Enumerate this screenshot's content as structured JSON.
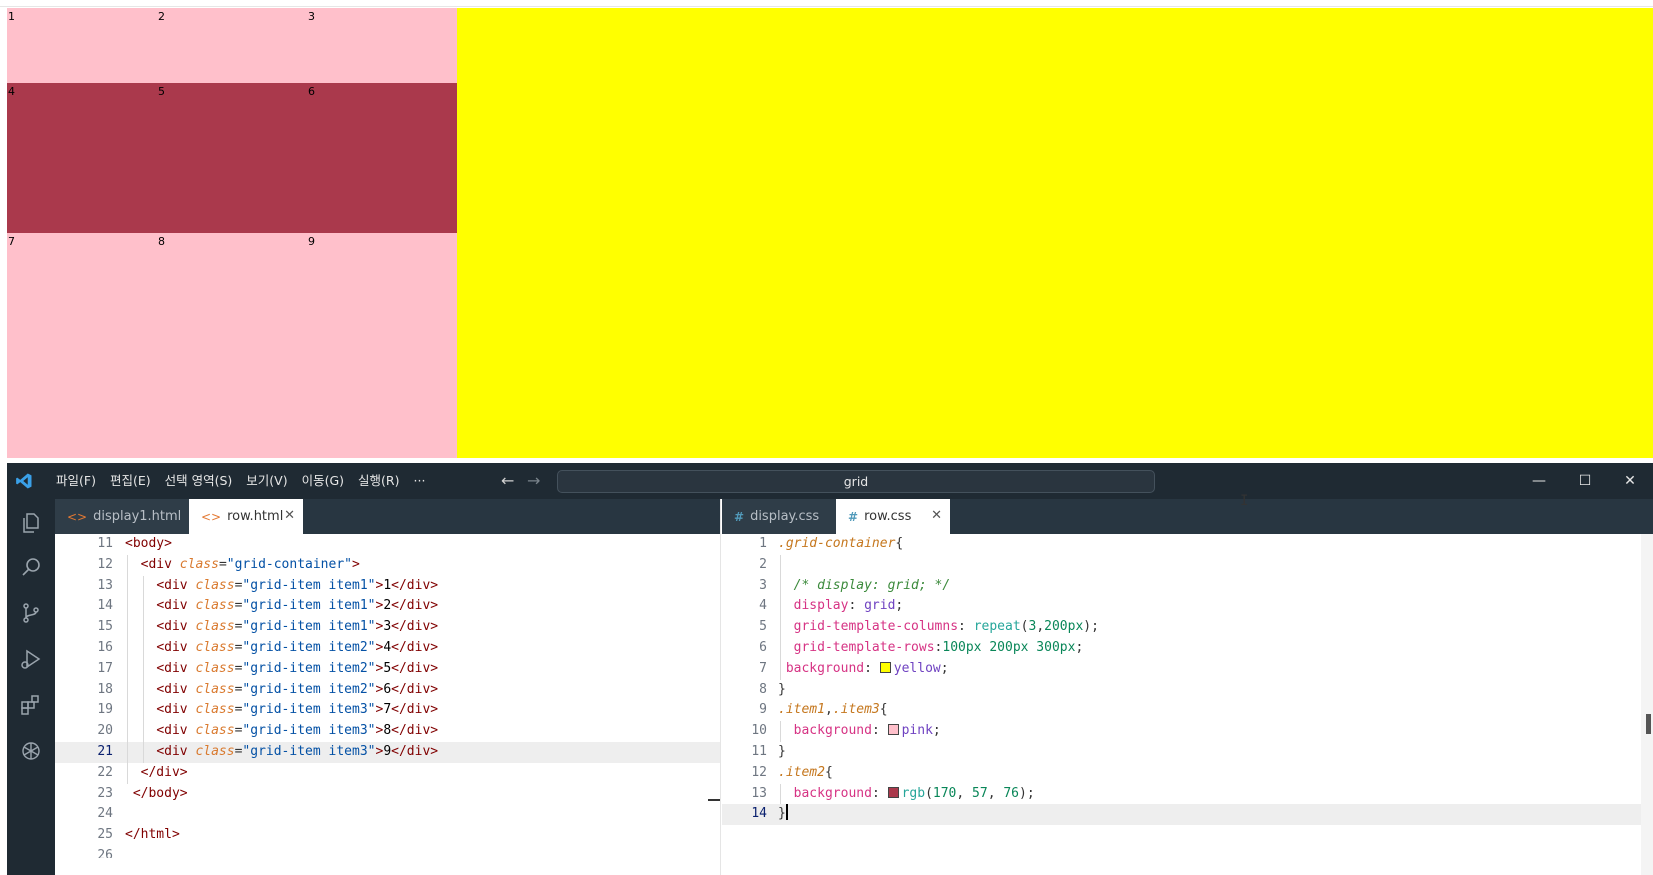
{
  "preview": {
    "cells": [
      {
        "label": "1",
        "row": "item1"
      },
      {
        "label": "2",
        "row": "item1"
      },
      {
        "label": "3",
        "row": "item1"
      },
      {
        "label": "4",
        "row": "item2"
      },
      {
        "label": "5",
        "row": "item2"
      },
      {
        "label": "6",
        "row": "item2"
      },
      {
        "label": "7",
        "row": "item3"
      },
      {
        "label": "8",
        "row": "item3"
      },
      {
        "label": "9",
        "row": "item3"
      }
    ],
    "colors": {
      "container": "#ffff00",
      "item1": "#ffc0cb",
      "item2": "#aa394c",
      "item3": "#ffc0cb"
    }
  },
  "titlebar": {
    "menus": [
      "파일(F)",
      "편집(E)",
      "선택 영역(S)",
      "보기(V)",
      "이동(G)",
      "실행(R)",
      "···"
    ],
    "search": "grid",
    "back_icon": "←",
    "forward_icon": "→",
    "minimize": "—",
    "maximize": "☐",
    "close": "✕"
  },
  "activity": [
    "explorer-icon",
    "search-icon",
    "source-control-icon",
    "run-debug-icon",
    "extensions-icon",
    "chatgpt-icon"
  ],
  "left_tabs": [
    {
      "label": "display1.html",
      "icon": "<>"
    },
    {
      "label": "row.html",
      "icon": "<>",
      "close": "✕"
    }
  ],
  "right_tabs": [
    {
      "label": "display.css",
      "icon": "#"
    },
    {
      "label": "row.css",
      "icon": "#",
      "close": "✕"
    }
  ],
  "left_code": {
    "line_numbers": [
      "11",
      "12",
      "13",
      "14",
      "15",
      "16",
      "17",
      "18",
      "19",
      "20",
      "21",
      "22",
      "23",
      "24",
      "25",
      "26"
    ],
    "current_line": "21"
  },
  "right_code": {
    "line_numbers": [
      "1",
      "2",
      "3",
      "4",
      "5",
      "6",
      "7",
      "8",
      "9",
      "10",
      "11",
      "12",
      "13",
      "14"
    ],
    "current_line": "14"
  }
}
